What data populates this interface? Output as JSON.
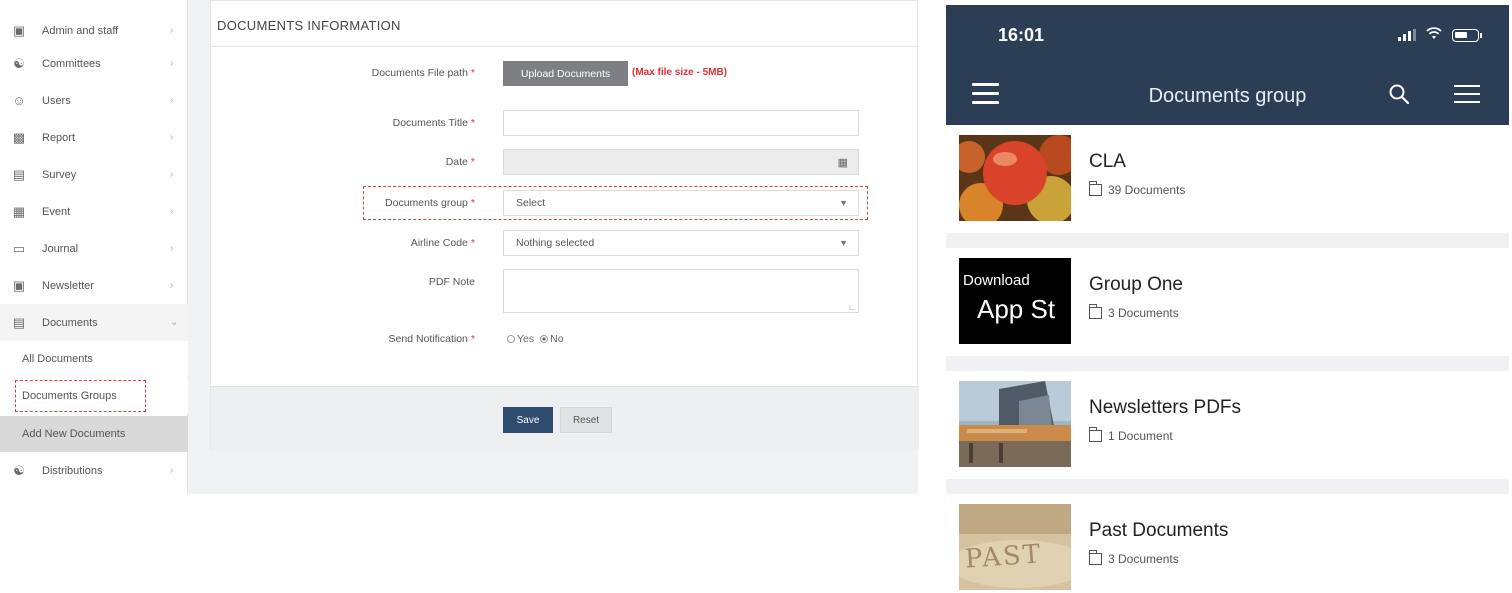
{
  "sidebar": {
    "items": [
      {
        "label": "Admin and staff",
        "icon": "people-icon"
      },
      {
        "label": "Committees",
        "icon": "group-icon"
      },
      {
        "label": "Users",
        "icon": "user-icon"
      },
      {
        "label": "Report",
        "icon": "report-icon"
      },
      {
        "label": "Survey",
        "icon": "survey-icon"
      },
      {
        "label": "Event",
        "icon": "calendar-icon"
      },
      {
        "label": "Journal",
        "icon": "journal-icon"
      },
      {
        "label": "Newsletter",
        "icon": "newsletter-icon"
      },
      {
        "label": "Documents",
        "icon": "document-icon"
      }
    ],
    "sub_items": [
      "All Documents",
      "Documents Groups",
      "Add New Documents"
    ],
    "last_item": {
      "label": "Distributions",
      "icon": "distribution-icon"
    }
  },
  "form": {
    "title": "DOCUMENTS INFORMATION",
    "labels": {
      "file_path": "Documents File path",
      "title": "Documents Title",
      "date": "Date",
      "group": "Documents group",
      "airline": "Airline Code",
      "pdf_note": "PDF Note",
      "notification": "Send Notification"
    },
    "upload_button": "Upload Documents",
    "max_size_note": "(Max file size - 5MB)",
    "title_value": "",
    "date_value": "",
    "group_value": "Select",
    "airline_value": "Nothing selected",
    "radio_yes": "Yes",
    "radio_no": "No",
    "notification_selected": "No",
    "save_label": "Save",
    "reset_label": "Reset"
  },
  "phone": {
    "time": "16:01",
    "title": "Documents group",
    "groups": [
      {
        "name": "CLA",
        "count": "39 Documents",
        "thumb": "apples"
      },
      {
        "name": "Group One",
        "count": "3 Documents",
        "thumb": "app-store",
        "thumb_text_1": "Download",
        "thumb_text_2": "App St"
      },
      {
        "name": "Newsletters PDFs",
        "count": "1 Document",
        "thumb": "building"
      },
      {
        "name": "Past Documents",
        "count": "3 Documents",
        "thumb": "past",
        "thumb_text_1": "PAST"
      }
    ]
  },
  "colors": {
    "header_navy": "#2c3e56",
    "save_button": "#2f4b6d",
    "upload_button": "#7d7f82",
    "required_red": "#e03030",
    "highlight_dash": "#e04040"
  }
}
